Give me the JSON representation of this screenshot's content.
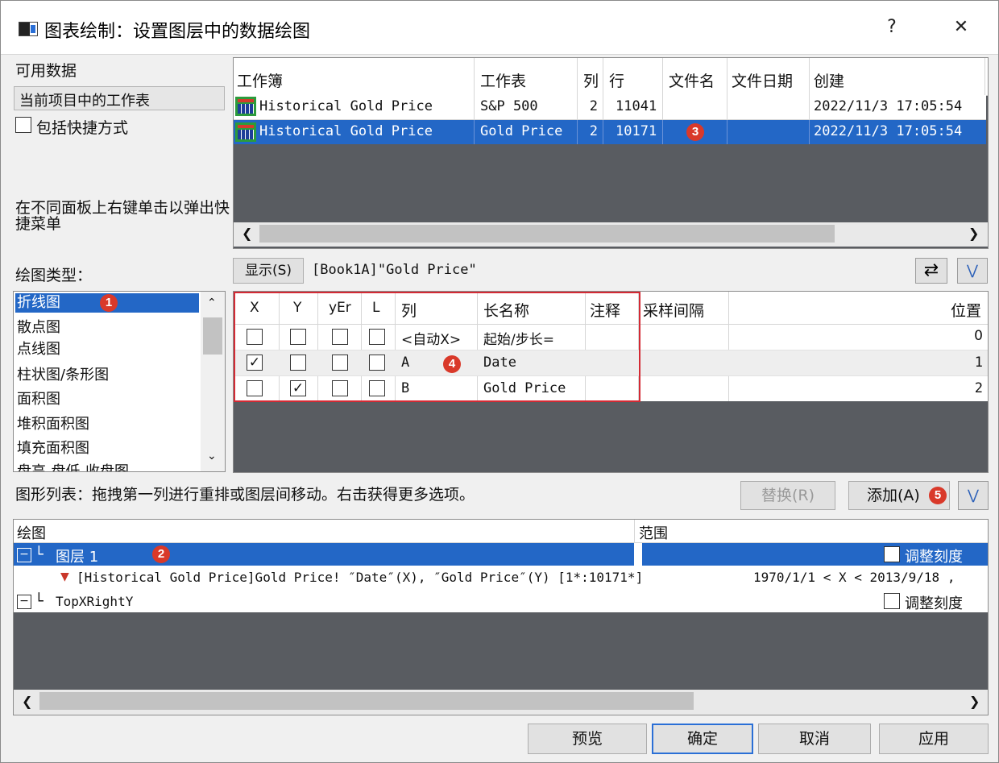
{
  "window": {
    "title": "图表绘制：设置图层中的数据绘图",
    "help": "?",
    "close": "✕"
  },
  "left": {
    "available_label": "可用数据",
    "source_select": "当前项目中的工作表",
    "include_shortcuts": "包括快捷方式",
    "hint": "在不同面板上右键单击以弹出快捷菜单",
    "plot_type_label": "绘图类型：",
    "plot_types": [
      "折线图",
      "散点图",
      "点线图",
      "柱状图/条形图",
      "面积图",
      "堆积面积图",
      "填充面积图",
      "盘高-盘低-收盘图"
    ]
  },
  "workbooks": {
    "headers": [
      "工作簿",
      "工作表",
      "列",
      "行",
      "文件名",
      "文件日期",
      "创建"
    ],
    "rows": [
      {
        "book": "Historical Gold Price",
        "sheet": "S&P 500",
        "cols": "2",
        "rows": "11041",
        "file": "",
        "date": "",
        "created": "2022/11/3 17:05:54"
      },
      {
        "book": "Historical Gold Price",
        "sheet": "Gold Price",
        "cols": "2",
        "rows": "10171",
        "file": "",
        "date": "",
        "created": "2022/11/3 17:05:54"
      }
    ]
  },
  "show_button": "显示(S)",
  "book_path": "[Book1A]\"Gold Price\"",
  "columns": {
    "headers": [
      "X",
      "Y",
      "yEr",
      "L",
      "列",
      "长名称",
      "注释",
      "采样间隔",
      "位置"
    ],
    "rows": [
      {
        "col": "<自动X>",
        "longname": "起始/步长=",
        "pos": "0",
        "x": false,
        "y": false
      },
      {
        "col": "A",
        "longname": "Date",
        "pos": "1",
        "x": true,
        "y": false
      },
      {
        "col": "B",
        "longname": "Gold Price",
        "pos": "2",
        "x": false,
        "y": true
      }
    ]
  },
  "plot_list": {
    "instruction": "图形列表：拖拽第一列进行重排或图层间移动。右击获得更多选项。",
    "replace": "替换(R)",
    "add": "添加(A)",
    "headers": [
      "绘图",
      "范围"
    ],
    "layer1": "图层 1",
    "rescale": "调整刻度",
    "plot_item": "[Historical Gold Price]Gold Price! ″Date″(X), ″Gold Price″(Y) [1*:10171*]",
    "plot_range": "1970/1/1 < X < 2013/9/18 ,",
    "layer2": "TopXRightY"
  },
  "buttons": {
    "preview": "预览",
    "ok": "确定",
    "cancel": "取消",
    "apply": "应用"
  },
  "badges": [
    "1",
    "2",
    "3",
    "4",
    "5"
  ],
  "colors": {
    "selection": "#2367c6",
    "badge": "#d9392a",
    "redbox": "#d42a34"
  }
}
